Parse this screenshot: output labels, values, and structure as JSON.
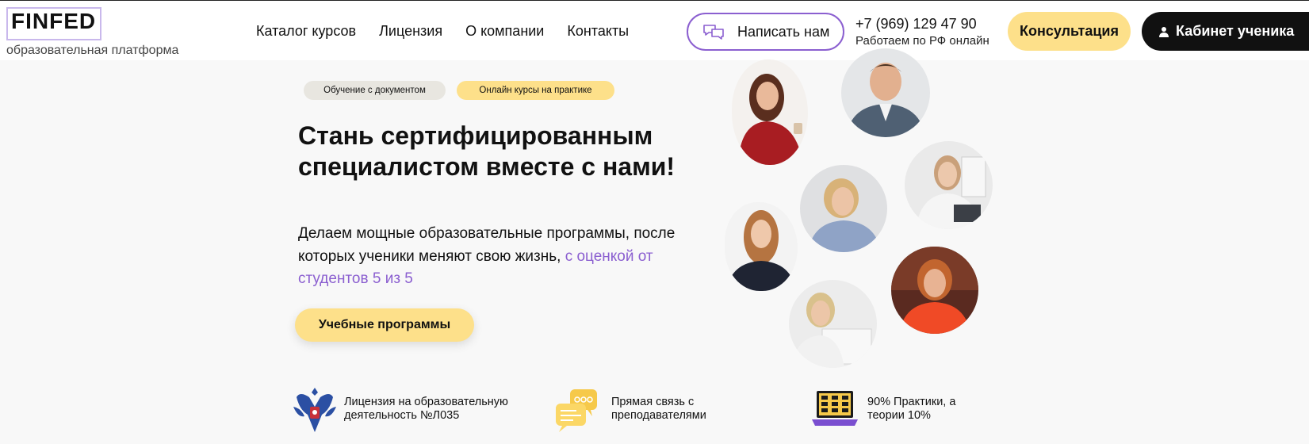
{
  "logo": {
    "text": "FINFED",
    "subtitle": "образовательная платформа"
  },
  "nav": {
    "items": [
      "Каталог курсов",
      "Лицензия",
      "О компании",
      "Контакты"
    ]
  },
  "header": {
    "write_label": "Написать нам",
    "phone": "+7 (969) 129 47 90",
    "phone_note": "Работаем по РФ онлайн",
    "consult_label": "Консультация",
    "cabinet_label": "Кабинет ученика"
  },
  "hero": {
    "tags": [
      "Обучение с документом",
      "Онлайн курсы на практике"
    ],
    "title": "Стань сертифицированным специалистом вместе с нами!",
    "desc_main": "Делаем мощные образовательные программы, после которых ученики меняют свою жизнь, ",
    "desc_accent": "с оценкой от студентов 5 из 5",
    "cta_label": "Учебные программы"
  },
  "features": [
    {
      "icon": "coat-of-arms-icon",
      "text_line1": "Лицензия на образовательную",
      "text_line2": "деятельность №Л035"
    },
    {
      "icon": "chat-bubbles-icon",
      "text_line1": "Прямая связь с",
      "text_line2": "преподавателями"
    },
    {
      "icon": "laptop-icon",
      "text_line1": "90% Практики, а",
      "text_line2": "теории 10%"
    }
  ],
  "colors": {
    "accent": "#8b5fd0",
    "yellow": "#fde08a",
    "dark": "#111111",
    "bg": "#f8f8f8"
  }
}
